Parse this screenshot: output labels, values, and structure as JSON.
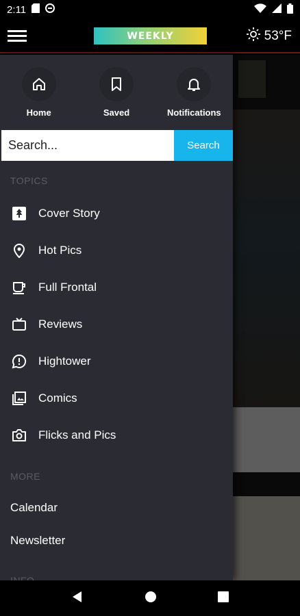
{
  "status_bar": {
    "time": "2:11"
  },
  "app_bar": {
    "logo_text": "WEEKLY",
    "weather": "53°F"
  },
  "drawer": {
    "quick_links": [
      {
        "label": "Home",
        "icon": "home-icon"
      },
      {
        "label": "Saved",
        "icon": "bookmark-icon"
      },
      {
        "label": "Notifications",
        "icon": "bell-icon"
      }
    ],
    "search": {
      "placeholder": "Search...",
      "button_label": "Search"
    },
    "topics_title": "TOPICS",
    "topics": [
      {
        "label": "Cover Story",
        "icon": "tree-icon"
      },
      {
        "label": "Hot Pics",
        "icon": "location-pin-icon"
      },
      {
        "label": "Full Frontal",
        "icon": "coffee-icon"
      },
      {
        "label": "Reviews",
        "icon": "tv-icon"
      },
      {
        "label": "Hightower",
        "icon": "chat-alert-icon"
      },
      {
        "label": "Comics",
        "icon": "photo-library-icon"
      },
      {
        "label": "Flicks and Pics",
        "icon": "camera-icon"
      }
    ],
    "more_title": "MORE",
    "more": [
      {
        "label": "Calendar"
      },
      {
        "label": "Newsletter"
      }
    ],
    "info_title": "INFO"
  },
  "colors": {
    "drawer_bg": "#2b2c33",
    "accent": "#17b5ec",
    "app_bar_rule": "#6b1a14"
  }
}
